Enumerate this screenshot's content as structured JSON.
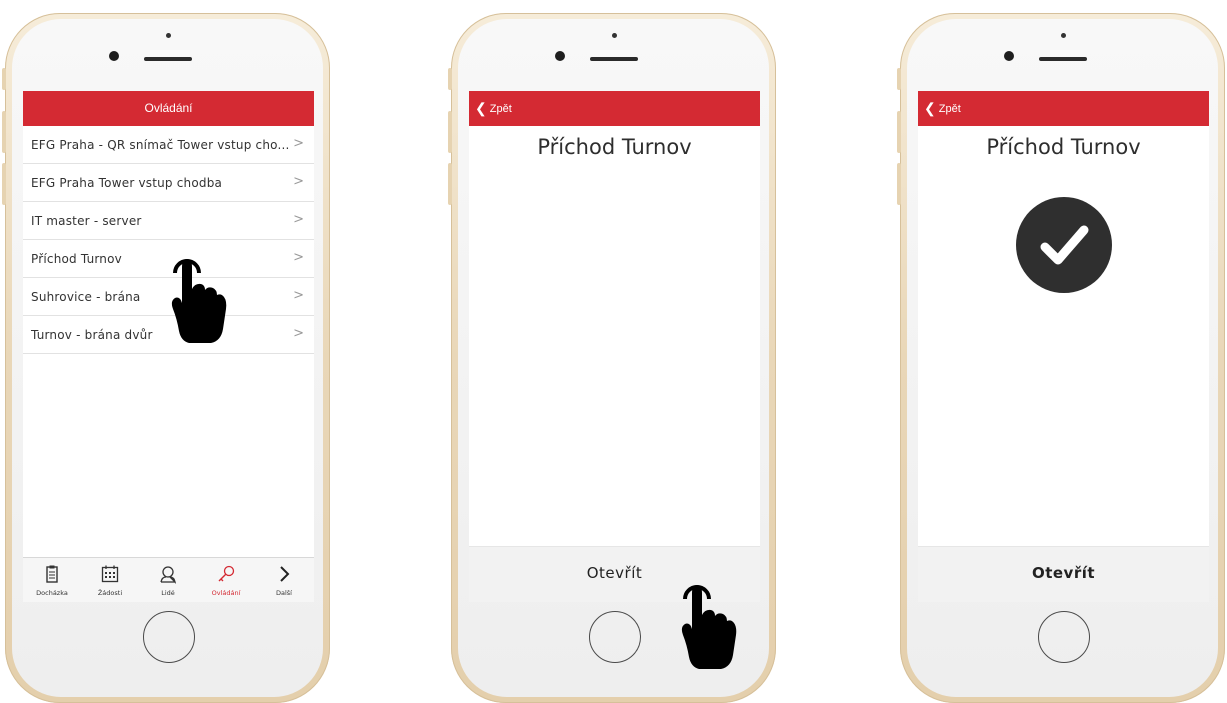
{
  "phones": [
    {
      "header": {
        "title": "Ovládání"
      },
      "list": [
        {
          "label": "EFG Praha - QR snímač Tower vstup cho..."
        },
        {
          "label": "EFG Praha Tower vstup chodba"
        },
        {
          "label": "IT master - server"
        },
        {
          "label": "Příchod Turnov"
        },
        {
          "label": "Suhrovice - brána"
        },
        {
          "label": "Turnov - brána dvůr"
        }
      ],
      "tabs": [
        {
          "label": "Docházka",
          "icon": "clipboard-icon"
        },
        {
          "label": "Žádosti",
          "icon": "calendar-icon"
        },
        {
          "label": "Lidé",
          "icon": "person-icon"
        },
        {
          "label": "Ovládání",
          "icon": "key-icon",
          "active": true
        },
        {
          "label": "Další",
          "icon": "chevron-right-icon"
        }
      ]
    },
    {
      "back_label": "Zpět",
      "door_title": "Příchod Turnov",
      "open_label": "Otevřít"
    },
    {
      "back_label": "Zpět",
      "door_title": "Příchod Turnov",
      "open_label": "Otevřít",
      "status_icon": "checkmark-icon"
    }
  ],
  "colors": {
    "accent": "#d42a33",
    "phone_gold": "#e9d7b8",
    "check_bg": "#2f2f2f"
  }
}
